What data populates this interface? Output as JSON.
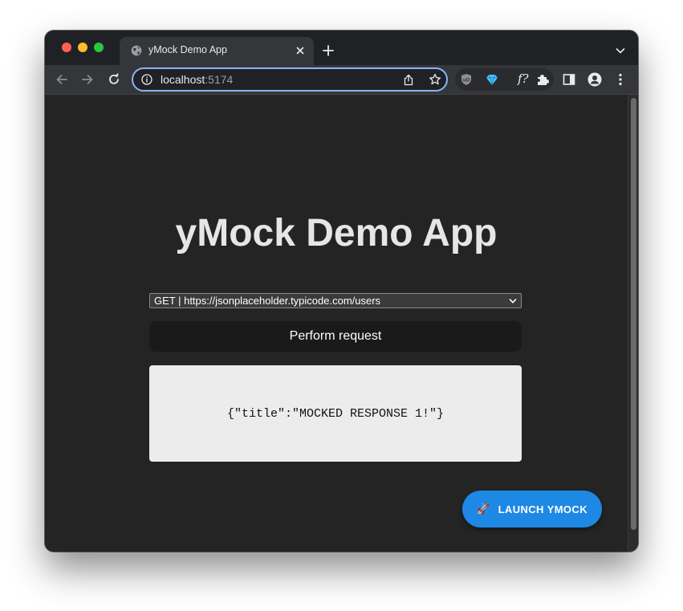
{
  "browser": {
    "tab_title": "yMock Demo App",
    "url_host": "localhost",
    "url_port": ":5174",
    "extension_fx_label": "f?"
  },
  "icons": {
    "favicon": "globe-icon",
    "tab_close": "close-icon",
    "new_tab": "plus-icon",
    "tab_search": "chevron-down-icon",
    "back": "arrow-left-icon",
    "forward": "arrow-right-icon",
    "reload": "reload-icon",
    "site_info": "info-icon",
    "share": "share-icon",
    "bookmark": "star-icon",
    "ublock": "shield-icon",
    "gem": "gem-icon",
    "extensions": "puzzle-icon",
    "side_panel": "side-panel-icon",
    "profile": "profile-icon",
    "menu": "kebab-menu-icon",
    "launch": "rocket-icon"
  },
  "app": {
    "title": "yMock Demo App",
    "endpoint_selected": "GET | https://jsonplaceholder.typicode.com/users",
    "perform_label": "Perform request",
    "response_text": "{\"title\":\"MOCKED RESPONSE 1!\"}",
    "launch_label": "LAUNCH YMOCK",
    "launch_emoji": "🚀"
  },
  "colors": {
    "page_background": "#242424",
    "title_text": "#e6e6e6",
    "launch_button": "#1e88e5",
    "omnibox_focus": "#8ab4f8"
  }
}
